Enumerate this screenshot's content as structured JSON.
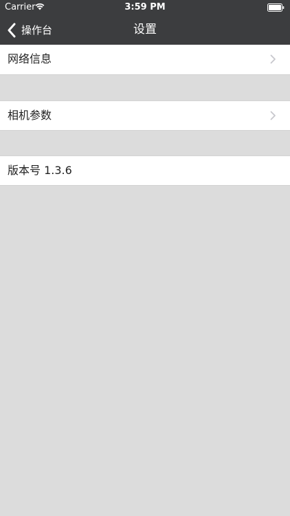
{
  "status_bar": {
    "carrier": "Carrier",
    "time": "3:59 PM"
  },
  "nav_bar": {
    "back_label": "操作台",
    "title": "设置"
  },
  "settings": {
    "network_info": "网络信息",
    "camera_params": "相机参数",
    "version": "版本号 1.3.6"
  },
  "colors": {
    "nav_background": "#3c3d3f",
    "page_background": "#dcdcdc",
    "row_background": "#ffffff",
    "chevron": "#c7c7cc"
  }
}
